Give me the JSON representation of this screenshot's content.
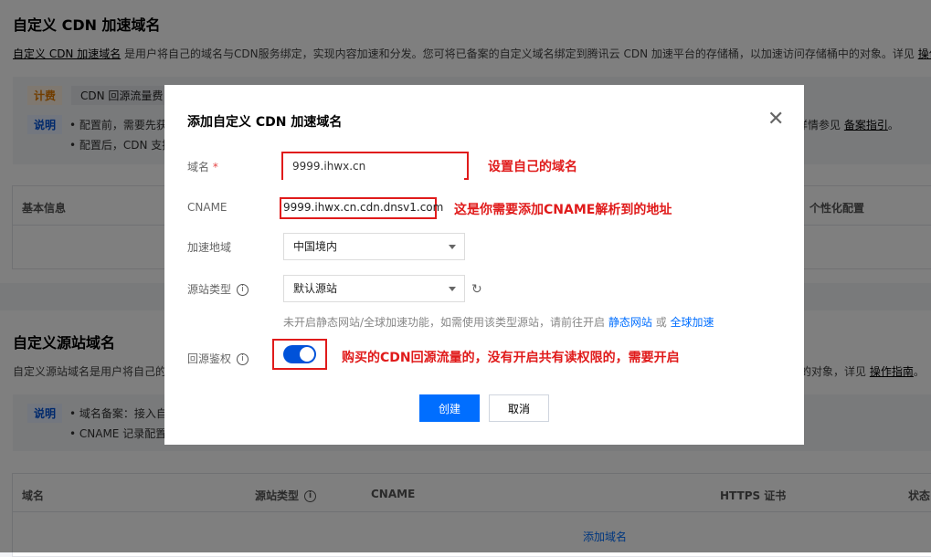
{
  "page": {
    "cdn_section": {
      "title": "自定义 CDN 加速域名",
      "desc_link": "自定义 CDN 加速域名",
      "desc_text": " 是用户将自己的域名与CDN服务绑定，实现内容加速和分发。您可将已备案的自定义域名绑定到腾讯云 CDN 加速平台的存储桶，以加速访问存储桶中的对象。详见 ",
      "desc_guide": "操作指南",
      "billing_tag": "计费",
      "billing_item": "CDN 回源流量费",
      "notes_tag": "说明",
      "note1": "• 配置前，需要先获",
      "note1_right": "详情参见 ",
      "note1_link": "备案指引",
      "note1_end": "。",
      "note2": "• 配置后，CDN 支持",
      "table_col1": "基本信息",
      "table_col_right": "个性化配置"
    },
    "origin_section": {
      "title": "自定义源站域名",
      "desc": "自定义源站域名是用户将自己的",
      "desc_right": "的对象，详见 ",
      "desc_guide": "操作指南",
      "desc_end": "。",
      "notes_tag": "说明",
      "note1": "• 域名备案：接入自",
      "note2": "• CNAME 记录配置",
      "columns": [
        "域名",
        "源站类型",
        "CNAME",
        "HTTPS 证书",
        "状态"
      ],
      "add_domain": "添加域名"
    }
  },
  "modal": {
    "title": "添加自定义 CDN 加速域名",
    "close": "✕",
    "domain_label": "域名",
    "required_mark": "*",
    "domain_value": "9999.ihwx.cn",
    "cname_label": "CNAME",
    "cname_value": "9999.ihwx.cn.cdn.dnsv1.com",
    "region_label": "加速地域",
    "region_value": "中国境内",
    "origin_type_label": "源站类型",
    "origin_type_value": "默认源站",
    "hint_text": "未开启静态网站/全球加速功能，如需使用该类型源站，请前往开启 ",
    "hint_link1": "静态网站",
    "hint_or": " 或 ",
    "hint_link2": "全球加速",
    "auth_label": "回源鉴权",
    "auth_enabled": true,
    "create_button": "创建",
    "cancel_button": "取消"
  },
  "annotations": {
    "domain_note": "设置自己的域名",
    "cname_note": "这是你需要添加CNAME解析到的地址",
    "auth_note": "购买的CDN回源流量的，没有开启共有读权限的，需要开启"
  },
  "icons": [
    "info-icon",
    "refresh-icon",
    "close-icon",
    "chevron-down-icon"
  ],
  "colors": {
    "primary": "#006eff",
    "annotation_red": "#e01b1b",
    "toggle_on": "#0052d9"
  }
}
